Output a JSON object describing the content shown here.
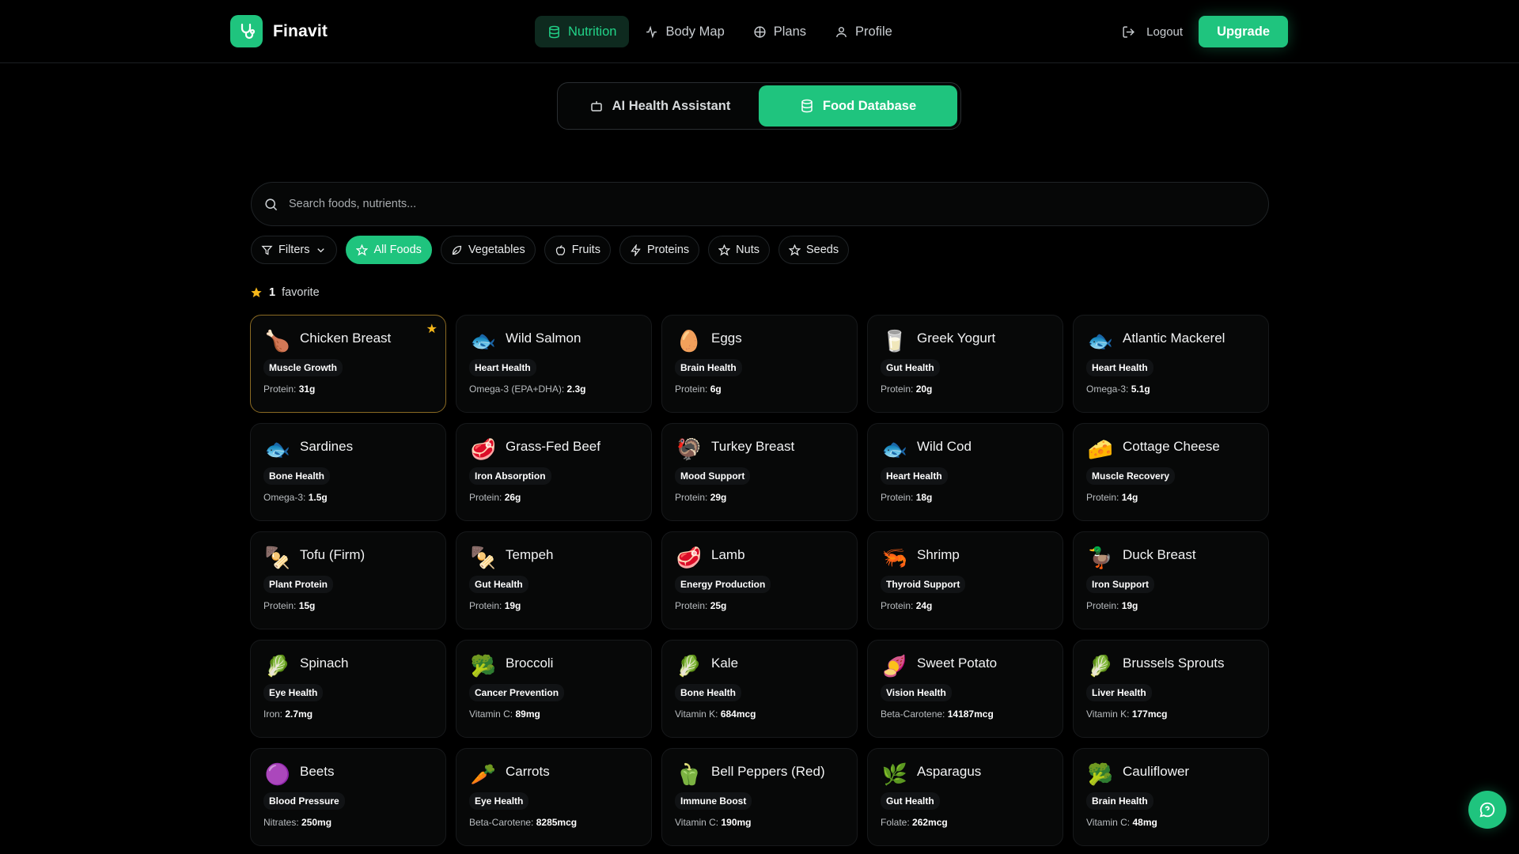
{
  "brand": {
    "name": "Finavit",
    "color": "#1fc47e"
  },
  "nav": {
    "links": [
      {
        "label": "Nutrition",
        "icon": "database-icon",
        "active": true
      },
      {
        "label": "Body Map",
        "icon": "activity-icon",
        "active": false
      },
      {
        "label": "Plans",
        "icon": "compass-icon",
        "active": false
      },
      {
        "label": "Profile",
        "icon": "user-icon",
        "active": false
      }
    ],
    "logout_label": "Logout",
    "upgrade_label": "Upgrade"
  },
  "segment": {
    "assistant_label": "AI Health Assistant",
    "database_label": "Food Database",
    "active": "Food Database"
  },
  "search": {
    "placeholder": "Search foods, nutrients..."
  },
  "filters": {
    "filters_label": "Filters",
    "chips": [
      {
        "label": "All Foods",
        "icon": "star-icon",
        "active": true
      },
      {
        "label": "Vegetables",
        "icon": "leaf-icon",
        "active": false
      },
      {
        "label": "Fruits",
        "icon": "apple-icon",
        "active": false
      },
      {
        "label": "Proteins",
        "icon": "lightning-icon",
        "active": false
      },
      {
        "label": "Nuts",
        "icon": "star-icon",
        "active": false
      },
      {
        "label": "Seeds",
        "icon": "star-icon",
        "active": false
      }
    ]
  },
  "favorites": {
    "count": "1",
    "label": "favorite"
  },
  "foods": [
    {
      "name": "Chicken Breast",
      "emoji": "🍗",
      "benefit": "Muscle Growth",
      "nutrient_label": "Protein:",
      "nutrient_value": "31g",
      "favorite": true
    },
    {
      "name": "Wild Salmon",
      "emoji": "🐟",
      "benefit": "Heart Health",
      "nutrient_label": "Omega-3 (EPA+DHA):",
      "nutrient_value": "2.3g",
      "favorite": false
    },
    {
      "name": "Eggs",
      "emoji": "🥚",
      "benefit": "Brain Health",
      "nutrient_label": "Protein:",
      "nutrient_value": "6g",
      "favorite": false
    },
    {
      "name": "Greek Yogurt",
      "emoji": "🥛",
      "benefit": "Gut Health",
      "nutrient_label": "Protein:",
      "nutrient_value": "20g",
      "favorite": false
    },
    {
      "name": "Atlantic Mackerel",
      "emoji": "🐟",
      "benefit": "Heart Health",
      "nutrient_label": "Omega-3:",
      "nutrient_value": "5.1g",
      "favorite": false
    },
    {
      "name": "Sardines",
      "emoji": "🐟",
      "benefit": "Bone Health",
      "nutrient_label": "Omega-3:",
      "nutrient_value": "1.5g",
      "favorite": false
    },
    {
      "name": "Grass-Fed Beef",
      "emoji": "🥩",
      "benefit": "Iron Absorption",
      "nutrient_label": "Protein:",
      "nutrient_value": "26g",
      "favorite": false
    },
    {
      "name": "Turkey Breast",
      "emoji": "🦃",
      "benefit": "Mood Support",
      "nutrient_label": "Protein:",
      "nutrient_value": "29g",
      "favorite": false
    },
    {
      "name": "Wild Cod",
      "emoji": "🐟",
      "benefit": "Heart Health",
      "nutrient_label": "Protein:",
      "nutrient_value": "18g",
      "favorite": false
    },
    {
      "name": "Cottage Cheese",
      "emoji": "🧀",
      "benefit": "Muscle Recovery",
      "nutrient_label": "Protein:",
      "nutrient_value": "14g",
      "favorite": false
    },
    {
      "name": "Tofu (Firm)",
      "emoji": "🍢",
      "benefit": "Plant Protein",
      "nutrient_label": "Protein:",
      "nutrient_value": "15g",
      "favorite": false
    },
    {
      "name": "Tempeh",
      "emoji": "🍢",
      "benefit": "Gut Health",
      "nutrient_label": "Protein:",
      "nutrient_value": "19g",
      "favorite": false
    },
    {
      "name": "Lamb",
      "emoji": "🥩",
      "benefit": "Energy Production",
      "nutrient_label": "Protein:",
      "nutrient_value": "25g",
      "favorite": false
    },
    {
      "name": "Shrimp",
      "emoji": "🦐",
      "benefit": "Thyroid Support",
      "nutrient_label": "Protein:",
      "nutrient_value": "24g",
      "favorite": false
    },
    {
      "name": "Duck Breast",
      "emoji": "🦆",
      "benefit": "Iron Support",
      "nutrient_label": "Protein:",
      "nutrient_value": "19g",
      "favorite": false
    },
    {
      "name": "Spinach",
      "emoji": "🥬",
      "benefit": "Eye Health",
      "nutrient_label": "Iron:",
      "nutrient_value": "2.7mg",
      "favorite": false
    },
    {
      "name": "Broccoli",
      "emoji": "🥦",
      "benefit": "Cancer Prevention",
      "nutrient_label": "Vitamin C:",
      "nutrient_value": "89mg",
      "favorite": false
    },
    {
      "name": "Kale",
      "emoji": "🥬",
      "benefit": "Bone Health",
      "nutrient_label": "Vitamin K:",
      "nutrient_value": "684mcg",
      "favorite": false
    },
    {
      "name": "Sweet Potato",
      "emoji": "🍠",
      "benefit": "Vision Health",
      "nutrient_label": "Beta-Carotene:",
      "nutrient_value": "14187mcg",
      "favorite": false
    },
    {
      "name": "Brussels Sprouts",
      "emoji": "🥬",
      "benefit": "Liver Health",
      "nutrient_label": "Vitamin K:",
      "nutrient_value": "177mcg",
      "favorite": false
    },
    {
      "name": "Beets",
      "emoji": "🟣",
      "benefit": "Blood Pressure",
      "nutrient_label": "Nitrates:",
      "nutrient_value": "250mg",
      "favorite": false
    },
    {
      "name": "Carrots",
      "emoji": "🥕",
      "benefit": "Eye Health",
      "nutrient_label": "Beta-Carotene:",
      "nutrient_value": "8285mcg",
      "favorite": false
    },
    {
      "name": "Bell Peppers (Red)",
      "emoji": "🫑",
      "benefit": "Immune Boost",
      "nutrient_label": "Vitamin C:",
      "nutrient_value": "190mg",
      "favorite": false
    },
    {
      "name": "Asparagus",
      "emoji": "🌿",
      "benefit": "Gut Health",
      "nutrient_label": "Folate:",
      "nutrient_value": "262mcg",
      "favorite": false
    },
    {
      "name": "Cauliflower",
      "emoji": "🥦",
      "benefit": "Brain Health",
      "nutrient_label": "Vitamin C:",
      "nutrient_value": "48mg",
      "favorite": false
    }
  ],
  "colors": {
    "accent": "#1fc47e",
    "favorite_star": "#f5b71a",
    "favorite_border": "#8a6a23"
  }
}
